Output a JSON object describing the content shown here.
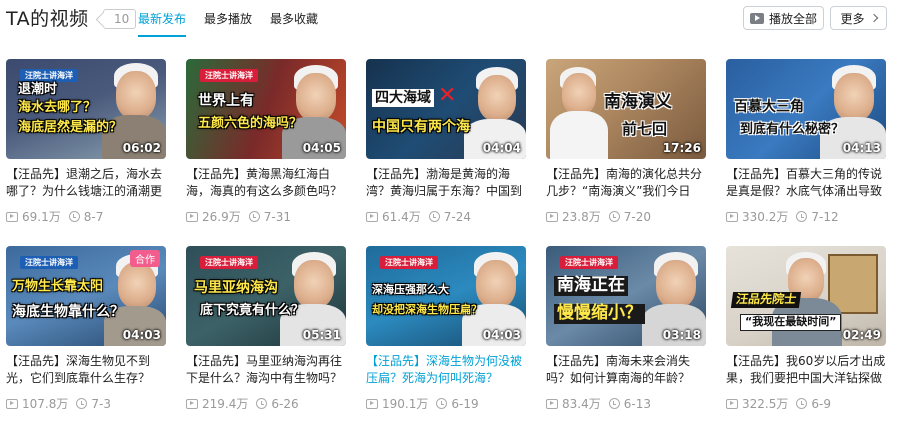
{
  "header": {
    "title": "TA的视频",
    "count": "10",
    "tabs": [
      {
        "label": "最新发布",
        "active": true
      },
      {
        "label": "最多播放",
        "active": false
      },
      {
        "label": "最多收藏",
        "active": false
      }
    ],
    "play_all_label": "播放全部",
    "more_label": "更多"
  },
  "accent_color": "#00a1d6",
  "videos": [
    {
      "duration": "06:02",
      "tag": "汪院士讲海洋",
      "caption": [
        "退潮时",
        "海水去哪了？",
        "海底居然是漏的？"
      ],
      "title": "【汪品先】退潮之后，海水去哪了？为什么钱塘江的涌潮更",
      "views": "69.1万",
      "date": "8-7"
    },
    {
      "duration": "04:05",
      "tag": "汪院士讲海洋",
      "caption": [
        "世界上有",
        "五颜六色的海吗？"
      ],
      "title": "【汪品先】黄海黑海红海白海，海真的有这么多颜色吗？",
      "views": "26.9万",
      "date": "7-31"
    },
    {
      "duration": "04:04",
      "caption": [
        "四大海域",
        "中国只有两个海"
      ],
      "title": "【汪品先】渤海是黄海的海湾？黄海归属于东海？中国到",
      "views": "61.4万",
      "date": "7-24"
    },
    {
      "duration": "17:26",
      "caption": [
        "南海演义",
        "前七回"
      ],
      "title": "【汪品先】南海的演化总共分几步？“南海演义”我们今日",
      "views": "23.8万",
      "date": "7-20"
    },
    {
      "duration": "04:13",
      "caption": [
        "百慕大三角",
        "到底有什么秘密？"
      ],
      "title": "【汪品先】百慕大三角的传说是真是假？水底气体涌出导致",
      "views": "330.2万",
      "date": "7-12"
    },
    {
      "duration": "04:03",
      "tag": "汪院士讲海洋",
      "badge": "合作",
      "caption": [
        "万物生长靠太阳",
        "海底生物靠什么？"
      ],
      "title": "【汪品先】深海生物见不到光，它们到底靠什么生存？",
      "views": "107.8万",
      "date": "7-3"
    },
    {
      "duration": "05:31",
      "tag": "汪院士讲海洋",
      "caption": [
        "马里亚纳海沟",
        "底下究竟有什么？"
      ],
      "title": "【汪品先】马里亚纳海沟再往下是什么？海沟中有生物吗？",
      "views": "219.4万",
      "date": "6-26"
    },
    {
      "duration": "04:03",
      "tag": "汪院士讲海洋",
      "caption": [
        "深海压强那么大",
        "却没把深海生物压扁？"
      ],
      "title": "【汪品先】深海生物为何没被压扁？死海为何叫死海？",
      "views": "190.1万",
      "date": "6-19",
      "highlight": true
    },
    {
      "duration": "03:18",
      "tag": "汪院士讲海洋",
      "caption": [
        "南海正在",
        "慢慢缩小？"
      ],
      "title": "【汪品先】南海未来会消失吗？如何计算南海的年龄？",
      "views": "83.4万",
      "date": "6-13"
    },
    {
      "duration": "02:49",
      "caption": [
        "汪品先院士",
        "“我现在最缺时间”"
      ],
      "title": "【汪品先】我60岁以后才出成果，我们要把中国大洋钻探做",
      "views": "322.5万",
      "date": "6-9"
    }
  ]
}
